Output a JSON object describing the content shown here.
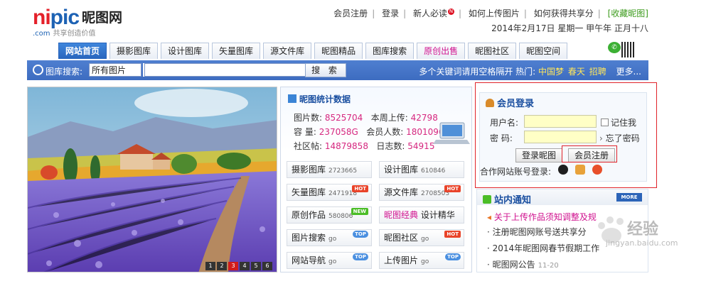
{
  "logo": {
    "en_red": "ni",
    "en_blue": "pic",
    "cn": "昵图网",
    "sub_com": ".com",
    "sub": "共享创造价值"
  },
  "toplinks": [
    "会员注册",
    "登录",
    "新人必读",
    "如何上传图片",
    "如何获得共享分",
    "[收藏昵图]"
  ],
  "date": "2014年2月17日  星期一  甲午年  正月十八",
  "tabs": [
    "网站首页",
    "摄影图库",
    "设计图库",
    "矢量图库",
    "源文件库",
    "昵图精品",
    "图库搜索",
    "原创出售",
    "昵图社区",
    "昵图空间"
  ],
  "search": {
    "label": "图库搜索:",
    "select": "所有图片",
    "button": "搜 索",
    "hint": "多个关键词请用空格隔开 热门:",
    "hot": [
      "中国梦",
      "春天",
      "招聘"
    ],
    "more": "更多..."
  },
  "slider": {
    "pages": [
      "1",
      "2",
      "3",
      "4",
      "5",
      "6"
    ],
    "active": "3"
  },
  "stats": {
    "title": "昵图统计数据",
    "rows": [
      {
        "l1": "图片数:",
        "v1": "8525704",
        "l2": "本周上传:",
        "v2": "42798"
      },
      {
        "l1": "容  量:",
        "v1": "237058G",
        "l2": "会员人数:",
        "v2": "18010961"
      },
      {
        "l1": "社区帖:",
        "v1": "14879858",
        "l2": "日志数:",
        "v2": "54915"
      }
    ],
    "tiles": [
      {
        "label": "摄影图库",
        "count": "2723665",
        "badge": ""
      },
      {
        "label": "设计图库",
        "count": "610846",
        "badge": ""
      },
      {
        "label": "矢量图库",
        "count": "2471918",
        "badge": "HOT"
      },
      {
        "label": "源文件库",
        "count": "2708503",
        "badge": "HOT"
      },
      {
        "label": "原创作品",
        "count": "580806",
        "badge": "NEW"
      },
      {
        "label": "昵图经典",
        "count": "设计精华",
        "badge": ""
      },
      {
        "label": "图片搜索",
        "count": "go",
        "badge": "TOP"
      },
      {
        "label": "昵图社区",
        "count": "go",
        "badge": "HOT"
      },
      {
        "label": "网站导航",
        "count": "go",
        "badge": "TOP"
      },
      {
        "label": "上传图片",
        "count": "go",
        "badge": "TOP"
      }
    ]
  },
  "login": {
    "title": "会员登录",
    "user_label": "用户名:",
    "pass_label": "密  码:",
    "remember": "记住我",
    "forgot": "忘了密码",
    "login_btn": "登录昵图",
    "register_btn": "会员注册",
    "partner": "合作网站账号登录:"
  },
  "notice": {
    "title": "站内通知",
    "more": "MORE",
    "items": [
      {
        "text": "关于上传作品须知调整及规",
        "time": ""
      },
      {
        "text": "注册昵图网账号送共享分",
        "time": ""
      },
      {
        "text": "2014年昵图网春节假期工作",
        "time": ""
      },
      {
        "text": "昵图网公告",
        "time": "11-20"
      }
    ]
  },
  "watermark": {
    "text": "经验",
    "url": "jingyan.baidu.com"
  },
  "colors": {
    "brand_red": "#e4202a",
    "brand_blue": "#1d62b4",
    "nav_blue": "#2865bd",
    "value_pink": "#d6277f"
  }
}
